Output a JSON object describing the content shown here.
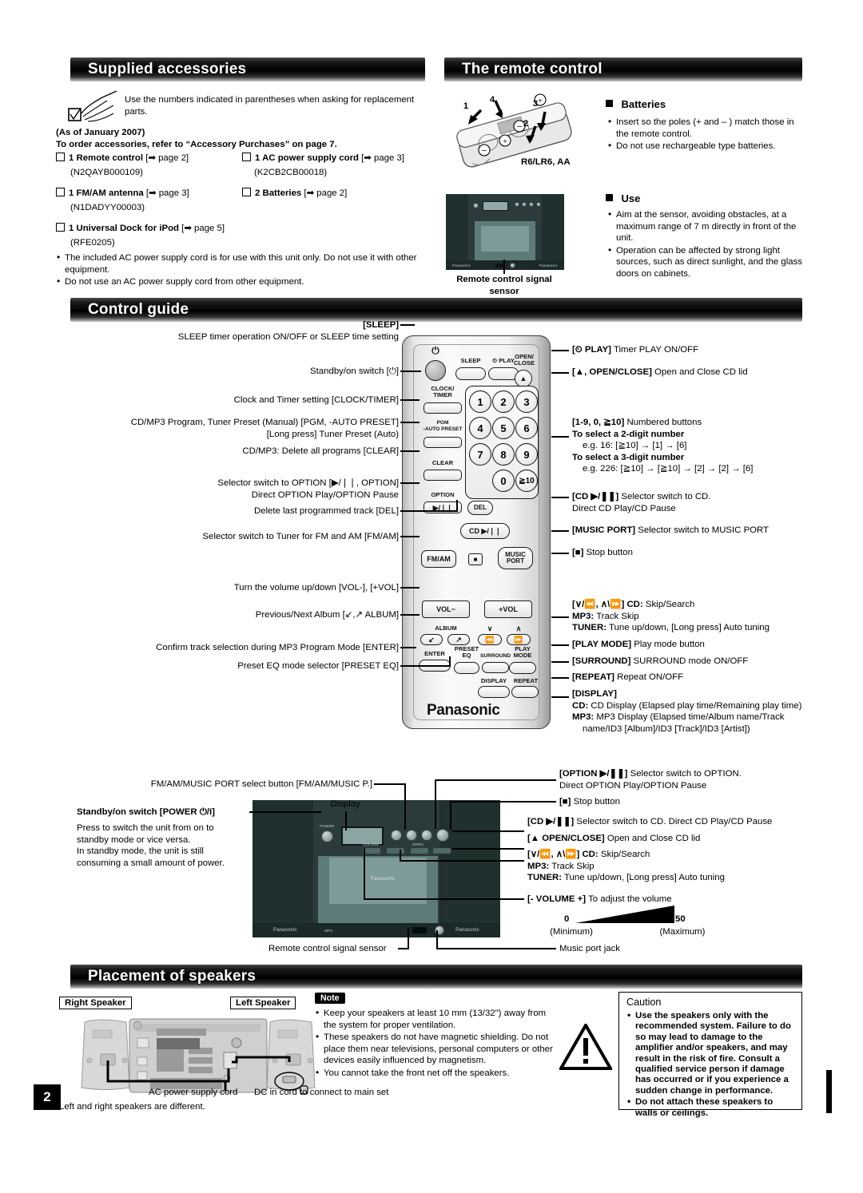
{
  "page": {
    "number": "2"
  },
  "sections": {
    "supplied": {
      "title": "Supplied accessories",
      "intro": "Use the numbers indicated in parentheses when asking for replacement parts.",
      "as_of": "(As of January 2007)",
      "order_line": "To order accessories, refer to “Accessory Purchases” on page 7.",
      "items": [
        {
          "qty_label": "1 Remote control",
          "ref": "[➡ page 2]",
          "part": "(N2QAYB000109)"
        },
        {
          "qty_label": "1 AC power supply cord",
          "ref": "[➡ page 3]",
          "part": "(K2CB2CB00018)"
        },
        {
          "qty_label": "1 FM/AM antenna",
          "ref": "[➡ page 3]",
          "part": "(N1DADYY00003)"
        },
        {
          "qty_label": "2 Batteries",
          "ref": "[➡ page 2]",
          "part": ""
        },
        {
          "qty_label": "1 Universal Dock for iPod",
          "ref": "[➡ page 5]",
          "part": "(RFE0205)"
        }
      ],
      "notes": [
        "The included AC power supply cord is for use with this unit only. Do not use it with other equipment.",
        "Do not use an AC power supply cord from other equipment."
      ]
    },
    "remote_control": {
      "title": "The remote control",
      "battery_type": "R6/LR6, AA",
      "callouts": [
        "1",
        "2",
        "3",
        "4"
      ],
      "sensor_caption": "Remote control signal sensor",
      "batteries": {
        "heading": "Batteries",
        "items": [
          "Insert so the poles (+ and – ) match those in the remote control.",
          "Do not use rechargeable type batteries."
        ]
      },
      "use": {
        "heading": "Use",
        "items": [
          "Aim at the sensor, avoiding obstacles, at a maximum range of 7 m directly in front of the unit.",
          "Operation can be affected by strong light sources, such as direct sunlight, and the glass doors on cabinets."
        ]
      }
    },
    "control_guide": {
      "title": "Control guide",
      "remote_left_labels": [
        {
          "main": "[SLEEP]",
          "bold_first": true,
          "sub": "SLEEP timer operation ON/OFF or SLEEP time setting"
        },
        {
          "main": "Standby/on switch [⏻]",
          "sub": ""
        },
        {
          "main": "Clock and Timer setting [CLOCK/TIMER]",
          "sub": ""
        },
        {
          "main": "CD/MP3 Program, Tuner Preset (Manual) [PGM, -AUTO PRESET]",
          "sub": "[Long press] Tuner Preset (Auto)"
        },
        {
          "main": "CD/MP3: Delete all programs [CLEAR]",
          "sub": ""
        },
        {
          "main": "Selector switch to OPTION [▶/❘❘, OPTION]",
          "sub": "Direct OPTION Play/OPTION Pause"
        },
        {
          "main": "Delete last programmed track [DEL]",
          "sub": ""
        },
        {
          "main": "Selector switch to Tuner for FM and AM [FM/AM]",
          "sub": ""
        },
        {
          "main": "Turn the volume up/down [VOL-], [+VOL]",
          "sub": ""
        },
        {
          "main": "Previous/Next Album [↙,↗ ALBUM]",
          "sub": ""
        },
        {
          "main": "Confirm track selection during MP3 Program Mode [ENTER]",
          "sub": ""
        },
        {
          "main": "Preset EQ mode selector [PRESET EQ]",
          "sub": ""
        }
      ],
      "remote_right_labels": [
        {
          "lines": [
            "[⏲ PLAY] Timer PLAY ON/OFF"
          ]
        },
        {
          "lines": [
            "[▲, OPEN/CLOSE] Open and Close CD lid"
          ]
        },
        {
          "lines": [
            "[1-9, 0, ≧10] Numbered buttons",
            "To select a 2-digit number",
            "e.g. 16: [≧10] → [1] → [6]",
            "To select a 3-digit number",
            "e.g. 226: [≧10] → [≧10] → [2] → [2] → [6]"
          ]
        },
        {
          "lines": [
            "[CD ▶/❘❘] Selector switch to CD.",
            "Direct CD Play/CD Pause"
          ]
        },
        {
          "lines": [
            "[MUSIC PORT] Selector switch to MUSIC PORT"
          ]
        },
        {
          "lines": [
            "[■] Stop button"
          ]
        },
        {
          "lines": [
            "[∨/⏪, ∧\\⏩] CD: Skip/Search",
            "MP3: Track Skip",
            "TUNER: Tune up/down, [Long press] Auto tuning"
          ]
        },
        {
          "lines": [
            "[PLAY MODE] Play mode button"
          ]
        },
        {
          "lines": [
            "[SURROUND] SURROUND mode ON/OFF"
          ]
        },
        {
          "lines": [
            "[REPEAT] Repeat ON/OFF"
          ]
        },
        {
          "lines": [
            "[DISPLAY]",
            "CD: CD Display (Elapsed play time/Remaining play time)",
            "MP3: MP3 Display (Elapsed time/Album name/Track",
            "name/ID3 [Album]/ID3 [Track]/ID3 [Artist])"
          ]
        }
      ],
      "remote_buttons": {
        "sleep": "SLEEP",
        "play": "⏲ PLAY",
        "open_close": "OPEN/\nCLOSE",
        "clock_timer": "CLOCK/\nTIMER",
        "pgm_auto_preset": "PGM\n-AUTO PRESET",
        "clear": "CLEAR",
        "option": "OPTION",
        "option_sym": "▶/❘❘",
        "del": "DEL",
        "cd_play": "CD ▶/❘❘",
        "fm_am": "FM/AM",
        "music_port": "MUSIC\nPORT",
        "vol_minus": "VOL−",
        "vol_plus": "+VOL",
        "album": "ALBUM",
        "enter": "ENTER",
        "preset_eq": "PRESET\nEQ",
        "surround": "SURROUND",
        "play_mode": "PLAY\nMODE",
        "display": "DISPLAY",
        "repeat": "REPEAT",
        "brand": "Panasonic",
        "numbers": [
          "1",
          "2",
          "3",
          "4",
          "5",
          "6",
          "7",
          "8",
          "9",
          "0",
          "≧10"
        ]
      },
      "unit_left_labels": [
        {
          "main": "FM/AM/MUSIC PORT select button [FM/AM/MUSIC P.]"
        },
        {
          "main": "Display"
        }
      ],
      "unit_standby": {
        "heading": "Standby/on switch [POWER ⏻/I]",
        "body": "Press to switch the unit from on to standby mode or vice versa.\nIn standby mode, the unit is still consuming a small amount of power."
      },
      "unit_sensor_caption": "Remote control signal sensor",
      "unit_right_labels": [
        {
          "lines": [
            "[OPTION ▶/❘❘] Selector switch to OPTION.",
            "Direct OPTION Play/OPTION Pause"
          ]
        },
        {
          "lines": [
            "[■] Stop button"
          ]
        },
        {
          "lines": [
            "[CD ▶/❘❘] Selector switch to CD. Direct CD Play/CD Pause"
          ]
        },
        {
          "lines": [
            "[▲ OPEN/CLOSE] Open and Close CD lid"
          ]
        },
        {
          "lines": [
            "[∨/⏪, ∧\\⏩] CD: Skip/Search",
            "MP3: Track Skip",
            "TUNER: Tune up/down, [Long press] Auto tuning"
          ]
        },
        {
          "lines": [
            "[- VOLUME +] To adjust the volume"
          ]
        },
        {
          "lines": [
            "Music port jack"
          ]
        }
      ],
      "volume_scale": {
        "min_value": "0",
        "min_label": "(Minimum)",
        "max_value": "50",
        "max_label": "(Maximum)"
      }
    },
    "speakers": {
      "title": "Placement of speakers",
      "right_speaker_tag": "Right Speaker",
      "left_speaker_tag": "Left Speaker",
      "ac_cord_label": "AC power supply cord",
      "dc_cord_label": "DC in cord to connect to main set",
      "footer": "Left and right speakers are different.",
      "note": {
        "tag": "Note",
        "items": [
          "Keep your speakers at least 10 mm (13/32\") away from the system for proper ventilation.",
          "These speakers do not have magnetic shielding. Do not place them near televisions, personal computers or other devices easily influenced by magnetism.",
          "You cannot take the front net off the speakers."
        ]
      },
      "caution": {
        "heading": "Caution",
        "items": [
          "Use the speakers only with the recommended system. Failure to do so may lead to damage to the amplifier and/or speakers, and may result in the risk of fire. Consult a qualified service person if damage has occurred or if you experience a sudden change in performance.",
          "Do not attach these speakers to walls or ceilings."
        ]
      }
    }
  }
}
